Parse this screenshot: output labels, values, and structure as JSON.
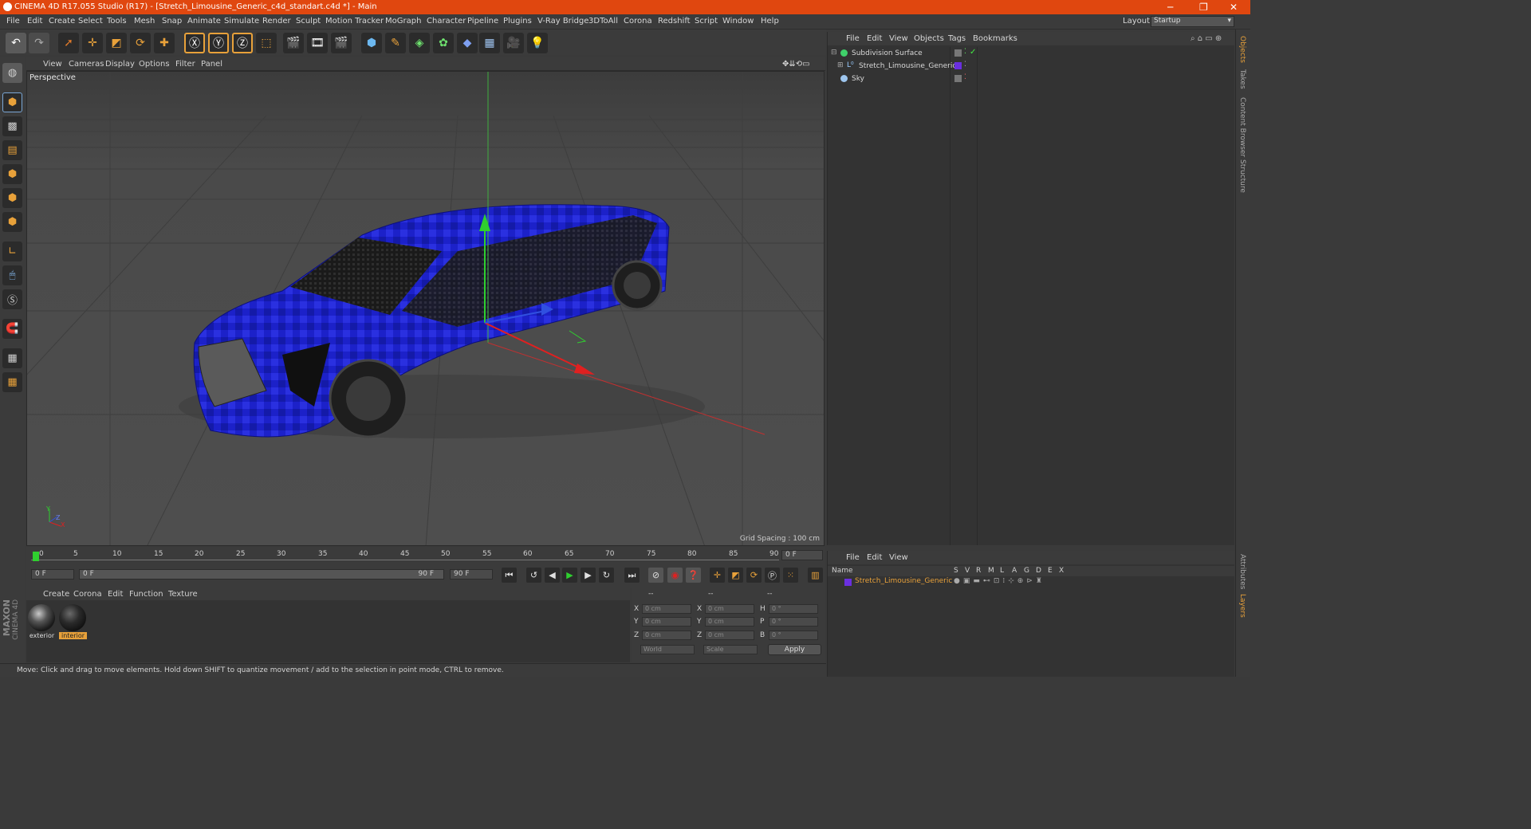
{
  "title_bar": {
    "title": "CINEMA 4D R17.055 Studio (R17) - [Stretch_Limousine_Generic_c4d_standart.c4d *] - Main",
    "minimize": "─",
    "restore": "❐",
    "close": "✕"
  },
  "menu": [
    "File",
    "Edit",
    "Create",
    "Select",
    "Tools",
    "Mesh",
    "Snap",
    "Animate",
    "Simulate",
    "Render",
    "Sculpt",
    "Motion Tracker",
    "MoGraph",
    "Character",
    "Pipeline",
    "Plugins",
    "V-Ray Bridge",
    "3DToAll",
    "Corona",
    "Redshift",
    "Script",
    "Window",
    "Help"
  ],
  "layout": {
    "label": "Layout:",
    "value": "Startup"
  },
  "viewport": {
    "menu": [
      "View",
      "Cameras",
      "Display",
      "Options",
      "Filter",
      "Panel"
    ],
    "label": "Perspective",
    "grid_spacing": "Grid Spacing : 100 cm",
    "axis_labels": {
      "x": "X",
      "y": "Y",
      "z": "Z"
    }
  },
  "timeline": {
    "ticks": [
      "0",
      "5",
      "10",
      "15",
      "20",
      "25",
      "30",
      "35",
      "40",
      "45",
      "50",
      "55",
      "60",
      "65",
      "70",
      "75",
      "80",
      "85",
      "90"
    ],
    "current_frame": "0 F",
    "start": "0 F",
    "range_start": "0 F",
    "range_end": "90 F",
    "end": "90 F"
  },
  "material_manager": {
    "menu": [
      "Create",
      "Corona",
      "Edit",
      "Function",
      "Texture"
    ],
    "materials": [
      {
        "name": "exterior"
      },
      {
        "name": "interior"
      }
    ]
  },
  "coordinates": {
    "headers": [
      "--",
      "--",
      "--"
    ],
    "rows": [
      {
        "a": "X",
        "av": "0 cm",
        "b": "X",
        "bv": "0 cm",
        "c": "H",
        "cv": "0 °"
      },
      {
        "a": "Y",
        "av": "0 cm",
        "b": "Y",
        "bv": "0 cm",
        "c": "P",
        "cv": "0 °"
      },
      {
        "a": "Z",
        "av": "0 cm",
        "b": "Z",
        "bv": "0 cm",
        "c": "B",
        "cv": "0 °"
      }
    ],
    "world": "World",
    "scale": "Scale",
    "apply": "Apply"
  },
  "status": "Move: Click and drag to move elements. Hold down SHIFT to quantize movement / add to the selection in point mode, CTRL to remove.",
  "object_manager": {
    "menu": [
      "File",
      "Edit",
      "View",
      "Objects",
      "Tags",
      "Bookmarks"
    ],
    "objects": [
      {
        "name": "Subdivision Surface"
      },
      {
        "name": "Stretch_Limousine_Generic"
      },
      {
        "name": "Sky"
      }
    ]
  },
  "layer_manager": {
    "menu": [
      "File",
      "Edit",
      "View"
    ],
    "columns": [
      "Name",
      "S",
      "V",
      "R",
      "M",
      "L",
      "A",
      "G",
      "D",
      "E",
      "X"
    ],
    "layers": [
      {
        "name": "Stretch_Limousine_Generic"
      }
    ]
  },
  "right_tabs": [
    "Objects",
    "Takes",
    "Content Browser",
    "Structure",
    "Attributes",
    "Layers"
  ],
  "brand": {
    "maxon": "MAXON",
    "cinema": "CINEMA 4D"
  }
}
